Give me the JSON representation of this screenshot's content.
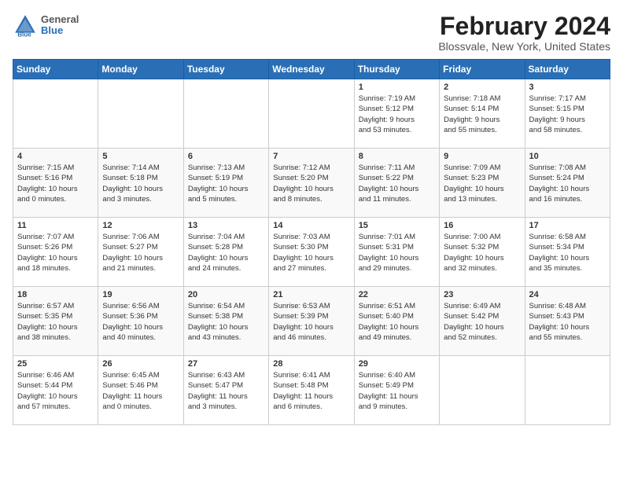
{
  "header": {
    "logo": {
      "general": "General",
      "blue": "Blue"
    },
    "title": "February 2024",
    "location": "Blossvale, New York, United States"
  },
  "weekdays": [
    "Sunday",
    "Monday",
    "Tuesday",
    "Wednesday",
    "Thursday",
    "Friday",
    "Saturday"
  ],
  "weeks": [
    [
      {
        "day": "",
        "info": ""
      },
      {
        "day": "",
        "info": ""
      },
      {
        "day": "",
        "info": ""
      },
      {
        "day": "",
        "info": ""
      },
      {
        "day": "1",
        "info": "Sunrise: 7:19 AM\nSunset: 5:12 PM\nDaylight: 9 hours\nand 53 minutes."
      },
      {
        "day": "2",
        "info": "Sunrise: 7:18 AM\nSunset: 5:14 PM\nDaylight: 9 hours\nand 55 minutes."
      },
      {
        "day": "3",
        "info": "Sunrise: 7:17 AM\nSunset: 5:15 PM\nDaylight: 9 hours\nand 58 minutes."
      }
    ],
    [
      {
        "day": "4",
        "info": "Sunrise: 7:15 AM\nSunset: 5:16 PM\nDaylight: 10 hours\nand 0 minutes."
      },
      {
        "day": "5",
        "info": "Sunrise: 7:14 AM\nSunset: 5:18 PM\nDaylight: 10 hours\nand 3 minutes."
      },
      {
        "day": "6",
        "info": "Sunrise: 7:13 AM\nSunset: 5:19 PM\nDaylight: 10 hours\nand 5 minutes."
      },
      {
        "day": "7",
        "info": "Sunrise: 7:12 AM\nSunset: 5:20 PM\nDaylight: 10 hours\nand 8 minutes."
      },
      {
        "day": "8",
        "info": "Sunrise: 7:11 AM\nSunset: 5:22 PM\nDaylight: 10 hours\nand 11 minutes."
      },
      {
        "day": "9",
        "info": "Sunrise: 7:09 AM\nSunset: 5:23 PM\nDaylight: 10 hours\nand 13 minutes."
      },
      {
        "day": "10",
        "info": "Sunrise: 7:08 AM\nSunset: 5:24 PM\nDaylight: 10 hours\nand 16 minutes."
      }
    ],
    [
      {
        "day": "11",
        "info": "Sunrise: 7:07 AM\nSunset: 5:26 PM\nDaylight: 10 hours\nand 18 minutes."
      },
      {
        "day": "12",
        "info": "Sunrise: 7:06 AM\nSunset: 5:27 PM\nDaylight: 10 hours\nand 21 minutes."
      },
      {
        "day": "13",
        "info": "Sunrise: 7:04 AM\nSunset: 5:28 PM\nDaylight: 10 hours\nand 24 minutes."
      },
      {
        "day": "14",
        "info": "Sunrise: 7:03 AM\nSunset: 5:30 PM\nDaylight: 10 hours\nand 27 minutes."
      },
      {
        "day": "15",
        "info": "Sunrise: 7:01 AM\nSunset: 5:31 PM\nDaylight: 10 hours\nand 29 minutes."
      },
      {
        "day": "16",
        "info": "Sunrise: 7:00 AM\nSunset: 5:32 PM\nDaylight: 10 hours\nand 32 minutes."
      },
      {
        "day": "17",
        "info": "Sunrise: 6:58 AM\nSunset: 5:34 PM\nDaylight: 10 hours\nand 35 minutes."
      }
    ],
    [
      {
        "day": "18",
        "info": "Sunrise: 6:57 AM\nSunset: 5:35 PM\nDaylight: 10 hours\nand 38 minutes."
      },
      {
        "day": "19",
        "info": "Sunrise: 6:56 AM\nSunset: 5:36 PM\nDaylight: 10 hours\nand 40 minutes."
      },
      {
        "day": "20",
        "info": "Sunrise: 6:54 AM\nSunset: 5:38 PM\nDaylight: 10 hours\nand 43 minutes."
      },
      {
        "day": "21",
        "info": "Sunrise: 6:53 AM\nSunset: 5:39 PM\nDaylight: 10 hours\nand 46 minutes."
      },
      {
        "day": "22",
        "info": "Sunrise: 6:51 AM\nSunset: 5:40 PM\nDaylight: 10 hours\nand 49 minutes."
      },
      {
        "day": "23",
        "info": "Sunrise: 6:49 AM\nSunset: 5:42 PM\nDaylight: 10 hours\nand 52 minutes."
      },
      {
        "day": "24",
        "info": "Sunrise: 6:48 AM\nSunset: 5:43 PM\nDaylight: 10 hours\nand 55 minutes."
      }
    ],
    [
      {
        "day": "25",
        "info": "Sunrise: 6:46 AM\nSunset: 5:44 PM\nDaylight: 10 hours\nand 57 minutes."
      },
      {
        "day": "26",
        "info": "Sunrise: 6:45 AM\nSunset: 5:46 PM\nDaylight: 11 hours\nand 0 minutes."
      },
      {
        "day": "27",
        "info": "Sunrise: 6:43 AM\nSunset: 5:47 PM\nDaylight: 11 hours\nand 3 minutes."
      },
      {
        "day": "28",
        "info": "Sunrise: 6:41 AM\nSunset: 5:48 PM\nDaylight: 11 hours\nand 6 minutes."
      },
      {
        "day": "29",
        "info": "Sunrise: 6:40 AM\nSunset: 5:49 PM\nDaylight: 11 hours\nand 9 minutes."
      },
      {
        "day": "",
        "info": ""
      },
      {
        "day": "",
        "info": ""
      }
    ]
  ]
}
